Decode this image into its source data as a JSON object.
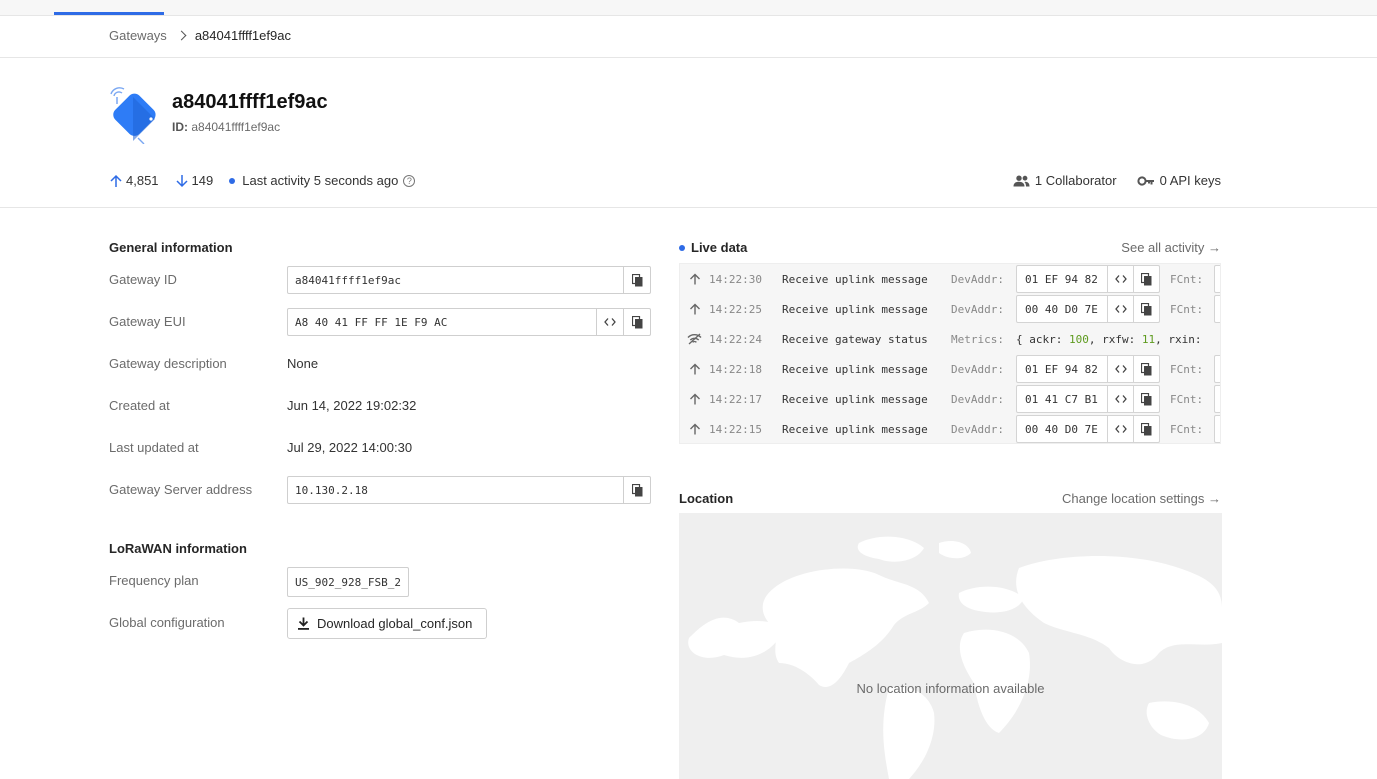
{
  "breadcrumb": {
    "root": "Gateways",
    "current": "a84041ffff1ef9ac"
  },
  "gateway": {
    "name": "a84041ffff1ef9ac",
    "id_label": "ID:",
    "id_value": "a84041ffff1ef9ac"
  },
  "stats": {
    "uplink_count": "4,851",
    "downlink_count": "149",
    "last_activity": "Last activity 5 seconds ago",
    "collaborators": "1 Collaborator",
    "api_keys": "0 API keys"
  },
  "general": {
    "title": "General information",
    "gateway_id_label": "Gateway ID",
    "gateway_id": "a84041ffff1ef9ac",
    "gateway_eui_label": "Gateway EUI",
    "gateway_eui": "A8 40 41 FF FF 1E F9 AC",
    "description_label": "Gateway description",
    "description": "None",
    "created_label": "Created at",
    "created": "Jun 14, 2022 19:02:32",
    "updated_label": "Last updated at",
    "updated": "Jul 29, 2022 14:00:30",
    "server_label": "Gateway Server address",
    "server": "10.130.2.18"
  },
  "lorawan": {
    "title": "LoRaWAN information",
    "freq_label": "Frequency plan",
    "freq": "US_902_928_FSB_2",
    "global_label": "Global configuration",
    "download": "Download global_conf.json"
  },
  "live": {
    "title": "Live data",
    "see_all": "See all activity →",
    "rows": [
      {
        "icon": "arrow-up-icon",
        "time": "14:22:30",
        "msg": "Receive uplink message",
        "label": "DevAddr:",
        "addr": "01 EF 94 82",
        "fcnt": "FCnt:"
      },
      {
        "icon": "arrow-up-icon",
        "time": "14:22:25",
        "msg": "Receive uplink message",
        "label": "DevAddr:",
        "addr": "00 40 D0 7E",
        "fcnt": "FCnt:"
      },
      {
        "icon": "wifi-icon",
        "time": "14:22:24",
        "msg": "Receive gateway status",
        "label": "Metrics:",
        "metrics": {
          "ackr_key": "{ ackr: ",
          "ackr": "100",
          "rxfw_key": ", rxfw: ",
          "rxfw": "11",
          "tail": ", rxin: "
        }
      },
      {
        "icon": "arrow-up-icon",
        "time": "14:22:18",
        "msg": "Receive uplink message",
        "label": "DevAddr:",
        "addr": "01 EF 94 82",
        "fcnt": "FCnt:"
      },
      {
        "icon": "arrow-up-icon",
        "time": "14:22:17",
        "msg": "Receive uplink message",
        "label": "DevAddr:",
        "addr": "01 41 C7 B1",
        "fcnt": "FCnt:"
      },
      {
        "icon": "arrow-up-icon",
        "time": "14:22:15",
        "msg": "Receive uplink message",
        "label": "DevAddr:",
        "addr": "00 40 D0 7E",
        "fcnt": "FCnt:"
      }
    ]
  },
  "location": {
    "title": "Location",
    "settings": "Change location settings →",
    "empty": "No location information available"
  },
  "colors": {
    "accent": "#2e6be6",
    "metric_number": "#5e9b1f"
  }
}
